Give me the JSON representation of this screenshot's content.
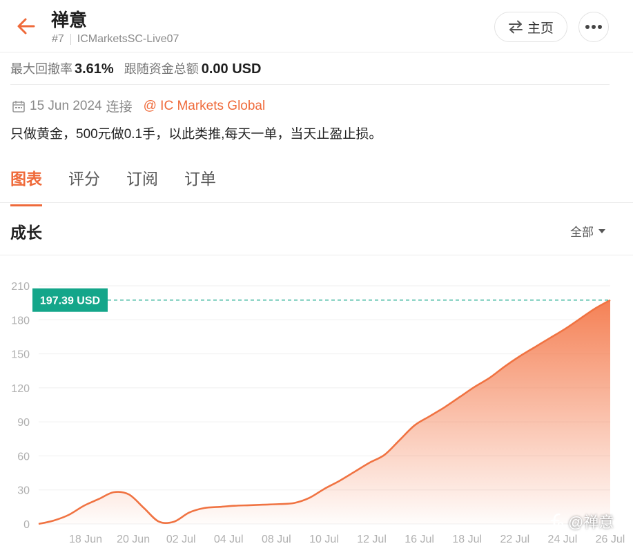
{
  "header": {
    "title": "禅意",
    "rank": "#7",
    "account": "ICMarketsSC-Live07",
    "home_label": "主页"
  },
  "stats": {
    "drawdown_label": "最大回撤率",
    "drawdown_value": "3.61%",
    "follow_label": "跟随资金总额",
    "follow_value": "0.00 USD"
  },
  "info": {
    "since_date": "15 Jun 2024",
    "since_suffix": "连接",
    "broker_link": "@ IC Markets Global",
    "description": "只做黄金，500元做0.1手，以此类推,每天一单，当天止盈止损。"
  },
  "tabs": [
    {
      "label": "图表",
      "active": true
    },
    {
      "label": "评分",
      "active": false
    },
    {
      "label": "订阅",
      "active": false
    },
    {
      "label": "订单",
      "active": false
    }
  ],
  "section": {
    "title": "成长",
    "range_label": "全部"
  },
  "watermark": "@禅意",
  "colors": {
    "accent": "#ef6a3a",
    "line": "#f07342",
    "tag_bg": "#14a68a"
  },
  "chart_data": {
    "type": "area",
    "current_value_label": "197.39 USD",
    "current_value": 197.39,
    "ylim": [
      0,
      210
    ],
    "yticks": [
      0,
      30,
      60,
      90,
      120,
      150,
      180,
      210
    ],
    "xtick_labels": [
      "18 Jun",
      "20 Jun",
      "02 Jul",
      "04 Jul",
      "08 Jul",
      "10 Jul",
      "12 Jul",
      "16 Jul",
      "18 Jul",
      "22 Jul",
      "24 Jul",
      "26 Jul"
    ],
    "series": [
      {
        "values": [
          0,
          3,
          8,
          16,
          22,
          28,
          26,
          14,
          2,
          2,
          10,
          14,
          15,
          16,
          16.5,
          17,
          17.5,
          18.5,
          23,
          31,
          38,
          46,
          54,
          61,
          74,
          87,
          95,
          103,
          112,
          121,
          129,
          139,
          148,
          156,
          164,
          172,
          181,
          190,
          197.39
        ]
      }
    ],
    "grid": true
  }
}
